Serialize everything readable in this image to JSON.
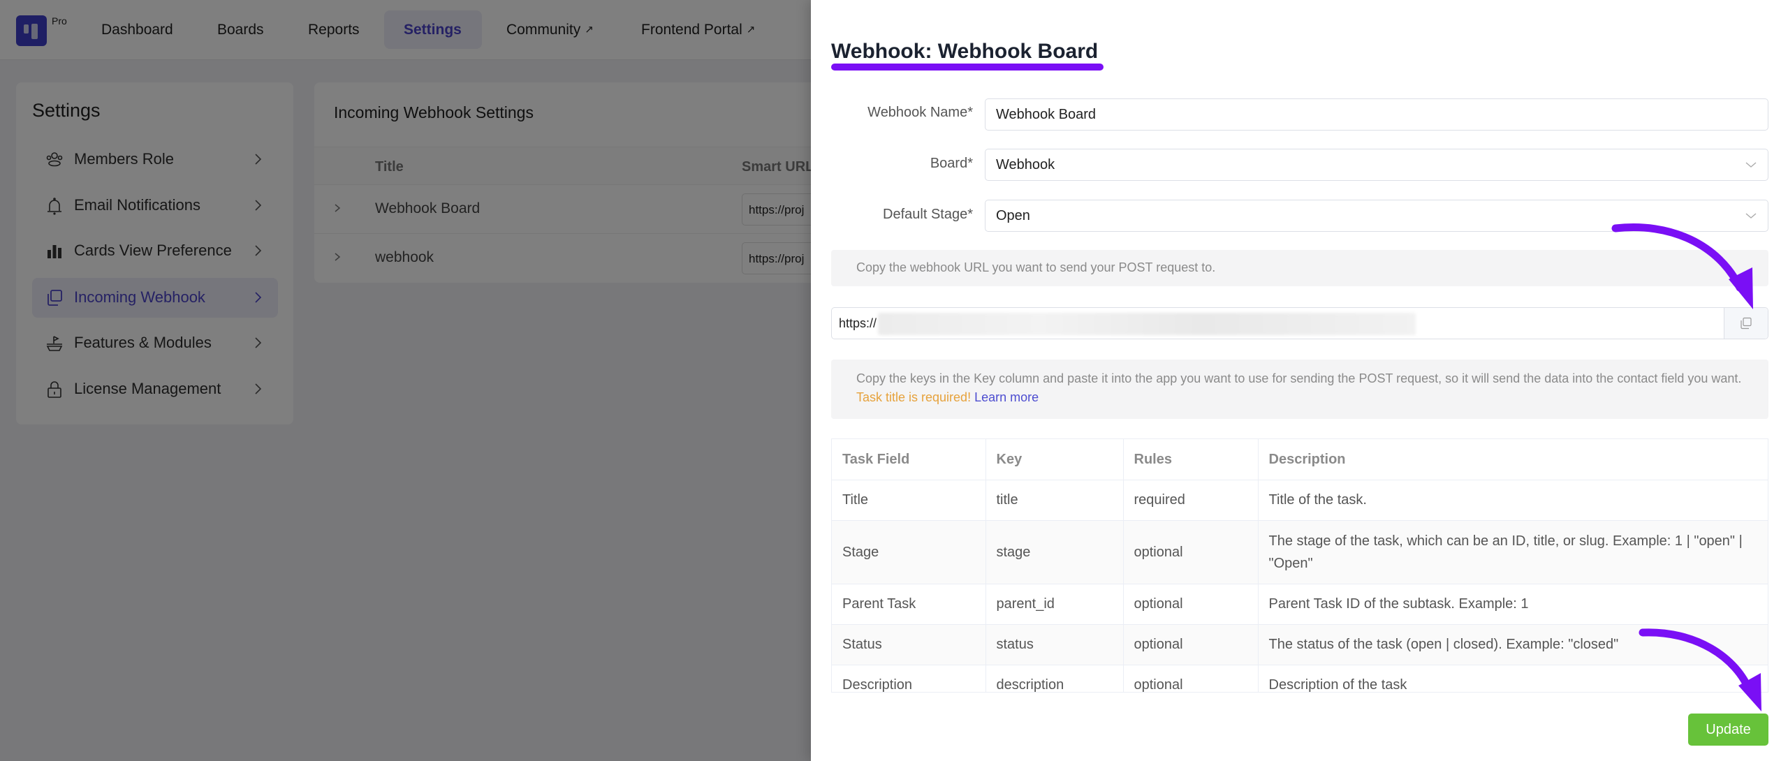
{
  "topnav": {
    "logo_badge": "Pro",
    "items": [
      {
        "label": "Dashboard",
        "external": false,
        "active": false
      },
      {
        "label": "Boards",
        "external": false,
        "active": false
      },
      {
        "label": "Reports",
        "external": false,
        "active": false
      },
      {
        "label": "Settings",
        "external": false,
        "active": true
      },
      {
        "label": "Community",
        "external": true,
        "active": false
      },
      {
        "label": "Frontend Portal",
        "external": true,
        "active": false
      }
    ],
    "external_icon": "↗"
  },
  "sidebar": {
    "title": "Settings",
    "items": [
      {
        "label": "Members Role",
        "icon": "members-icon",
        "active": false
      },
      {
        "label": "Email Notifications",
        "icon": "bell-icon",
        "active": false
      },
      {
        "label": "Cards View Preference",
        "icon": "bar-chart-icon",
        "active": false
      },
      {
        "label": "Incoming Webhook",
        "icon": "copy-icon",
        "active": true
      },
      {
        "label": "Features & Modules",
        "icon": "boat-icon",
        "active": false
      },
      {
        "label": "License Management",
        "icon": "lock-icon",
        "active": false
      }
    ]
  },
  "panel": {
    "title": "Incoming Webhook Settings",
    "columns": [
      "Title",
      "Smart URL"
    ],
    "rows": [
      {
        "title": "Webhook Board",
        "url": "https://proj"
      },
      {
        "title": "webhook",
        "url": "https://proj"
      }
    ]
  },
  "drawer": {
    "title": "Webhook: Webhook Board",
    "fields": {
      "webhook_name": {
        "label": "Webhook Name*",
        "value": "Webhook Board"
      },
      "board": {
        "label": "Board*",
        "value": "Webhook"
      },
      "default_stage": {
        "label": "Default Stage*",
        "value": "Open"
      }
    },
    "url_help": "Copy the webhook URL you want to send your POST request to.",
    "url_value": "https://",
    "keys_help": "Copy the keys in the Key column and paste it into the app you want to use for sending the POST request, so it will send the data into the contact field you want.",
    "keys_warning": "Task title is required!",
    "learn_more": "Learn more",
    "table": {
      "columns": [
        "Task Field",
        "Key",
        "Rules",
        "Description"
      ],
      "rows": [
        [
          "Title",
          "title",
          "required",
          "Title of the task."
        ],
        [
          "Stage",
          "stage",
          "optional",
          "The stage of the task, which can be an ID, title, or slug. Example: 1 | \"open\" | \"Open\""
        ],
        [
          "Parent Task",
          "parent_id",
          "optional",
          "Parent Task ID of the subtask. Example: 1"
        ],
        [
          "Status",
          "status",
          "optional",
          "The status of the task (open | closed). Example: \"closed\""
        ],
        [
          "Description",
          "description",
          "optional",
          "Description of the task"
        ]
      ]
    },
    "update_label": "Update"
  },
  "colors": {
    "accent": "#4a42c8",
    "annotation": "#7a0ff5",
    "update_button": "#67c23a",
    "warning": "#e6a23c"
  }
}
